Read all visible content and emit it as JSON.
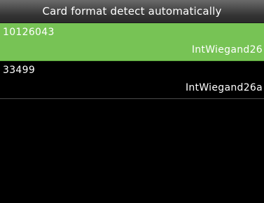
{
  "title_bar": {
    "title": "Card format detect automatically"
  },
  "cards": [
    {
      "number": "10126043",
      "format": "IntWiegand26",
      "selected": true
    },
    {
      "number": "33499",
      "format": "IntWiegand26a",
      "selected": false
    }
  ],
  "colors": {
    "selected_row": "#77c355",
    "background": "#000000",
    "text": "#ffffff"
  }
}
